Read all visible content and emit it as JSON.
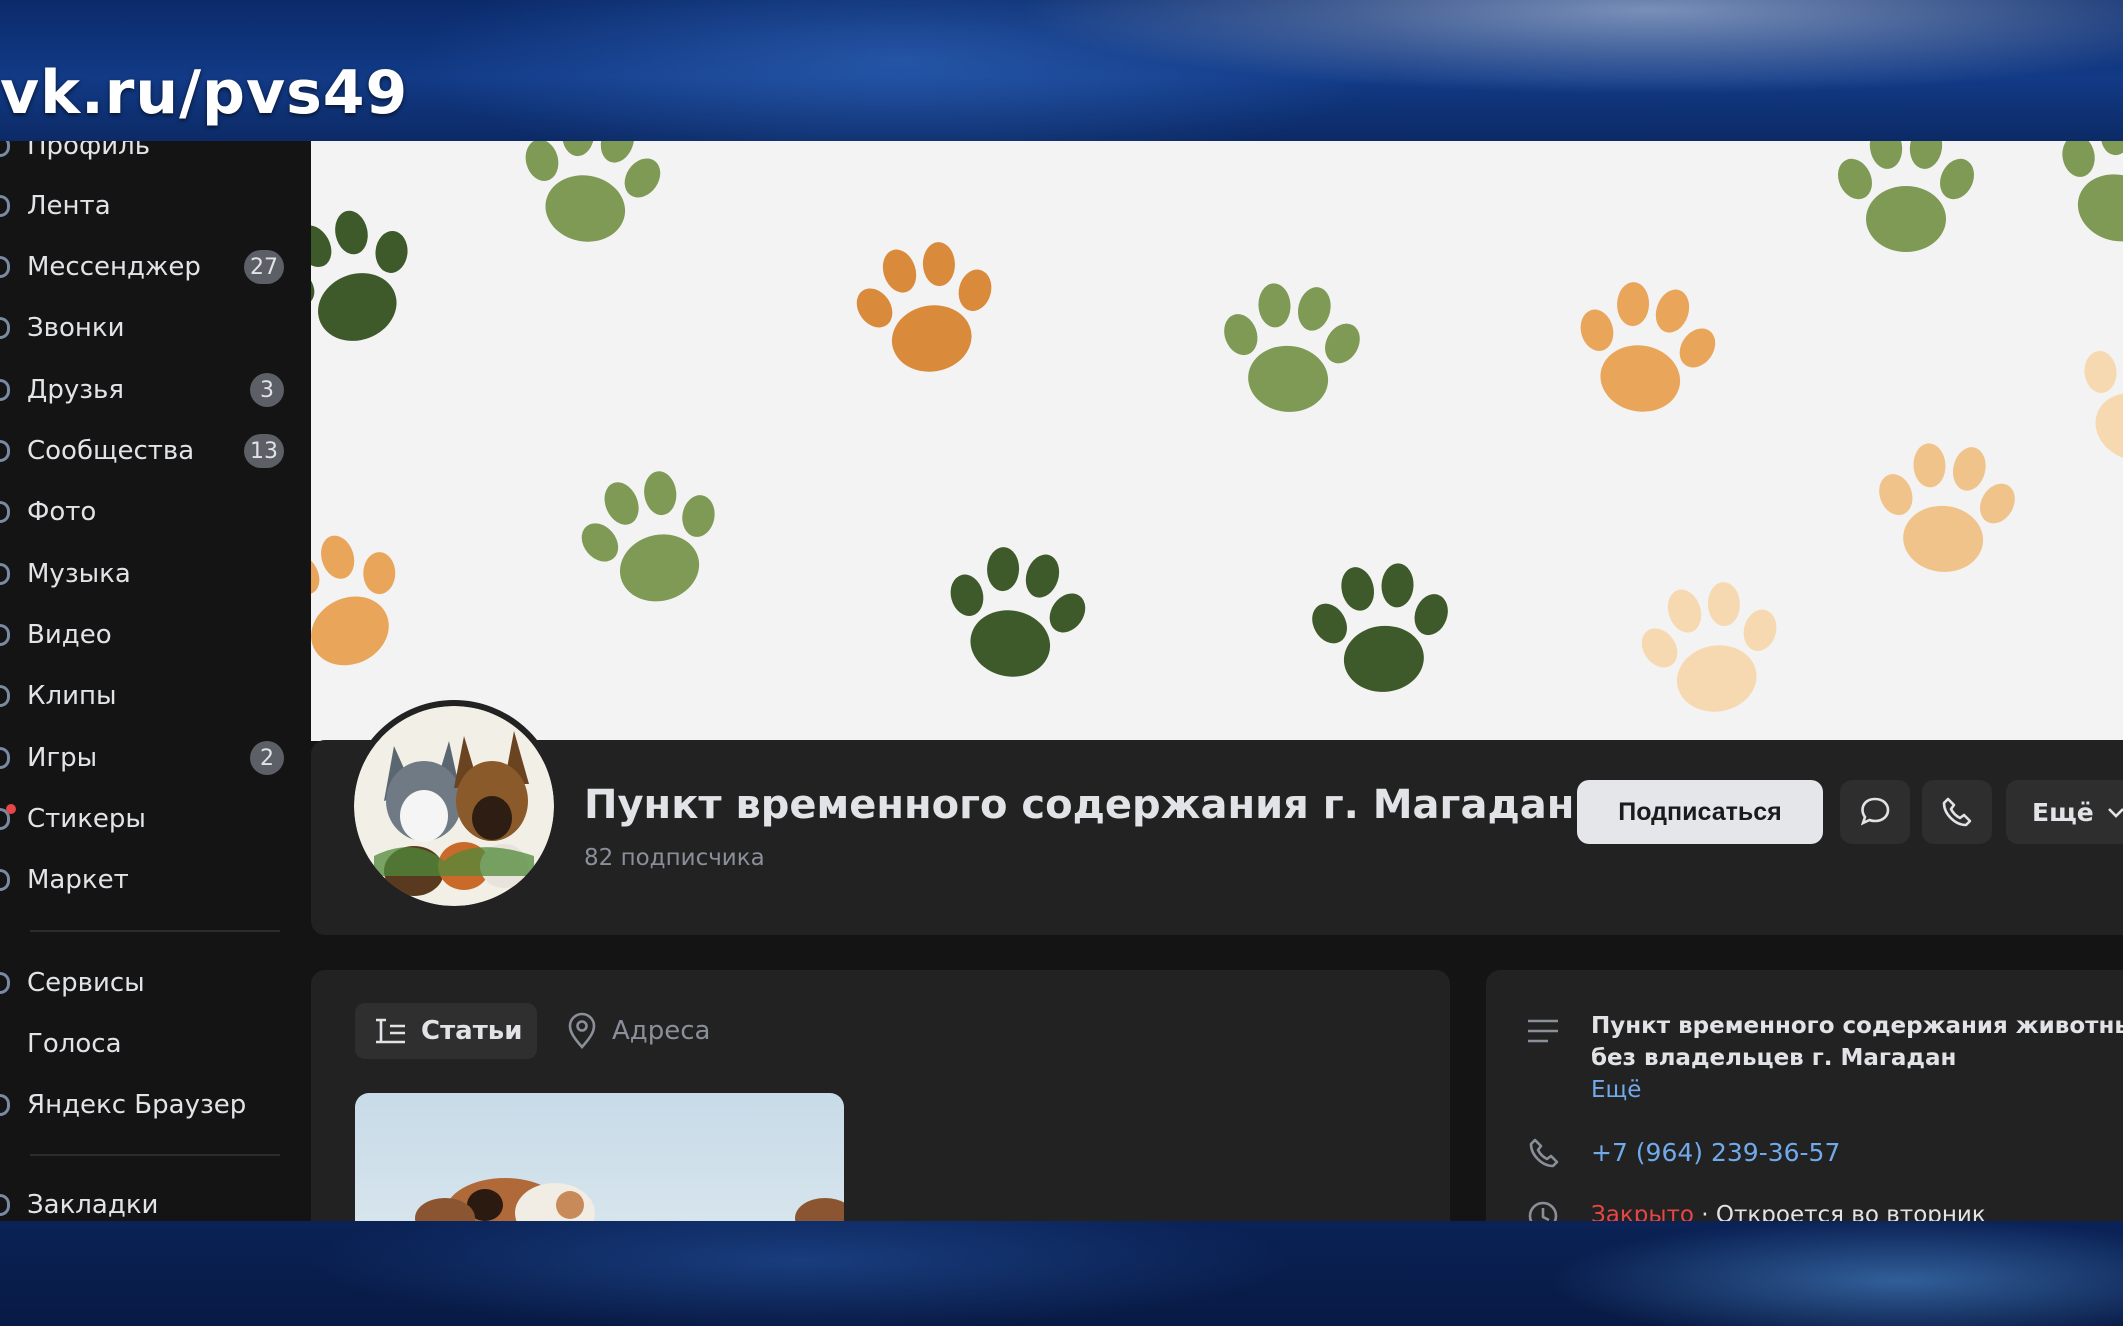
{
  "overlay": {
    "url": "vk.ru/pvs49"
  },
  "sidebar": {
    "items": [
      {
        "label": "Профиль"
      },
      {
        "label": "Лента"
      },
      {
        "label": "Мессенджер",
        "badge": "27"
      },
      {
        "label": "Звонки"
      },
      {
        "label": "Друзья",
        "badge": "3"
      },
      {
        "label": "Сообщества",
        "badge": "13"
      },
      {
        "label": "Фото"
      },
      {
        "label": "Музыка"
      },
      {
        "label": "Видео"
      },
      {
        "label": "Клипы"
      },
      {
        "label": "Игры",
        "badge": "2"
      },
      {
        "label": "Стикеры"
      },
      {
        "label": "Маркет"
      }
    ],
    "extra_items": [
      {
        "label": "Сервисы"
      },
      {
        "label": "Голоса"
      },
      {
        "label": "Яндекс Браузер"
      }
    ],
    "bottom_items": [
      {
        "label": "Закладки"
      }
    ]
  },
  "group": {
    "name": "Пункт временного содержания г. Магадан",
    "subscribers": "82 подписчика",
    "subscribe_label": "Подписаться",
    "more_label": "Ещё"
  },
  "tabs": [
    {
      "label": "Статьи",
      "icon": "articles-icon"
    },
    {
      "label": "Адреса",
      "icon": "location-pin-icon"
    }
  ],
  "info": {
    "description": "Пункт временного содержания животных без владельцев г. Магадан",
    "more_link": "Ещё",
    "phone": "+7 (964) 239-36-57",
    "status_closed": "Закрыто",
    "status_next": "· Откроется во вторник"
  },
  "colors": {
    "background": "#141414",
    "card": "#222222",
    "link": "#71aaeb",
    "closed": "#e64646",
    "paw_dark": "#3f5a2a",
    "paw_green": "#7e9a55",
    "paw_orange": "#d98a3a",
    "paw_light": "#f0c38a"
  }
}
